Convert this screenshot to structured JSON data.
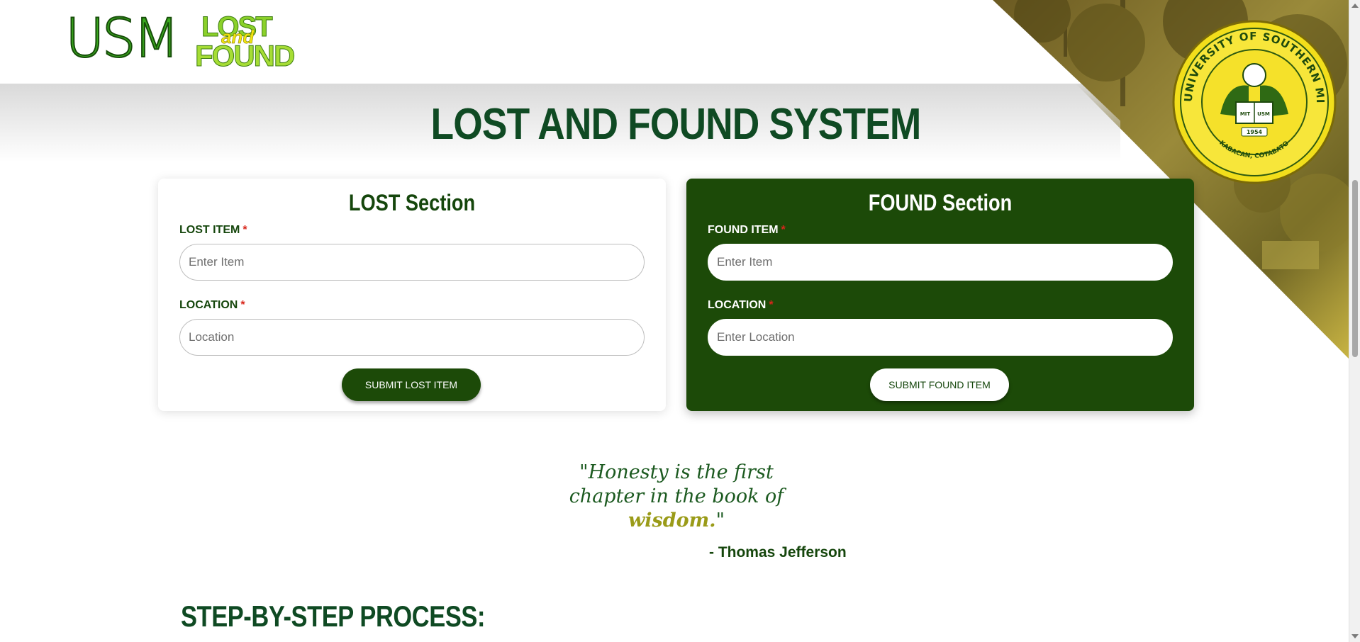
{
  "logo": {
    "usm": "USM",
    "lost": "LOST",
    "and": "and",
    "found": "FOUND"
  },
  "seal": {
    "ring_text": "UNIVERSITY OF SOUTHERN MINDANAO",
    "bottom_text": "KABACAN, COTABATO",
    "year": "1954",
    "book_left": "MIT",
    "book_right": "USM"
  },
  "page_title": "LOST AND FOUND SYSTEM",
  "lost_section": {
    "title": "LOST Section",
    "item_label": "LOST ITEM",
    "item_placeholder": "Enter Item",
    "location_label": "LOCATION",
    "location_placeholder": "Location",
    "required_mark": "*",
    "submit_label": "SUBMIT LOST ITEM"
  },
  "found_section": {
    "title": "FOUND Section",
    "item_label": "FOUND ITEM",
    "item_placeholder": "Enter Item",
    "location_label": "LOCATION",
    "location_placeholder": "Enter Location",
    "required_mark": "*",
    "submit_label": "SUBMIT FOUND ITEM"
  },
  "quote": {
    "line1": "\"Honesty is the first",
    "line2": "chapter in the book of",
    "highlight": "wisdom.",
    "closing": "\"",
    "author": "- Thomas Jefferson"
  },
  "steps": {
    "title": "STEP-BY-STEP PROCESS:"
  },
  "colors": {
    "brand_green": "#1c4a08",
    "title_green": "#0f4a23",
    "seal_yellow": "#f2de1b",
    "required_red": "#d8261b"
  }
}
